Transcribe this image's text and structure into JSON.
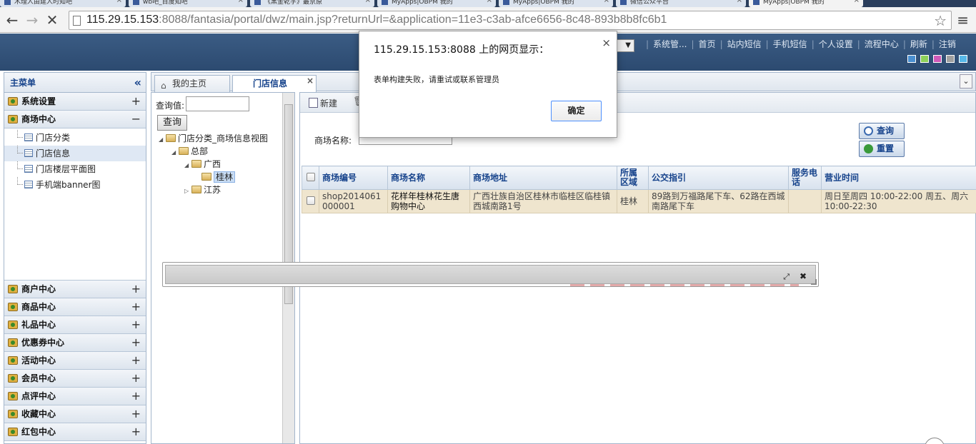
{
  "browser": {
    "tabs": [
      {
        "label": "木理人由建人时知吧"
      },
      {
        "label": "wb吧_百度知吧"
      },
      {
        "label": "《黑金乾学》最京原"
      },
      {
        "label": "MyApps|OBPM 我的"
      },
      {
        "label": "MyApps|OBPM 我的"
      },
      {
        "label": "微信公众平台"
      },
      {
        "label": "MyApps|OBPM 我的"
      }
    ],
    "url_host": "115.29.15.153",
    "url_rest": ":8088/fantasia/portal/dwz/main.jsp?returnUrl=&application=11e3-c3ab-afce6656-8c48-893b8b8fc6b1"
  },
  "header": {
    "links": [
      "系统管...",
      "首页",
      "站内短信",
      "手机短信",
      "个人设置",
      "流程中心",
      "刷新",
      "注销"
    ],
    "theme_colors": [
      "#4a8fd0",
      "#8ed15a",
      "#d05ab8",
      "#a0a0a0",
      "#57b8e8"
    ]
  },
  "sidebar": {
    "title": "主菜单",
    "groups_top": [
      {
        "label": "系统设置",
        "state": "+"
      },
      {
        "label": "商场中心",
        "state": "−"
      }
    ],
    "sub_items": [
      {
        "label": "门店分类"
      },
      {
        "label": "门店信息"
      },
      {
        "label": "门店楼层平面图"
      },
      {
        "label": "手机端banner图"
      }
    ],
    "groups_bottom": [
      {
        "label": "商户中心",
        "state": "+"
      },
      {
        "label": "商品中心",
        "state": "+"
      },
      {
        "label": "礼品中心",
        "state": "+"
      },
      {
        "label": "优惠券中心",
        "state": "+"
      },
      {
        "label": "活动中心",
        "state": "+"
      },
      {
        "label": "会员中心",
        "state": "+"
      },
      {
        "label": "点评中心",
        "state": "+"
      },
      {
        "label": "收藏中心",
        "state": "+"
      },
      {
        "label": "红包中心",
        "state": "+"
      }
    ]
  },
  "content_tabs": [
    {
      "label": "我的主页"
    },
    {
      "label": "门店信息"
    }
  ],
  "tree_panel": {
    "query_label": "查询值:",
    "query_button": "查询",
    "nodes": [
      {
        "label": "门店分类_商场信息视图"
      },
      {
        "label": "总部"
      },
      {
        "label": "广西"
      },
      {
        "label": "桂林"
      },
      {
        "label": "江苏"
      }
    ]
  },
  "grid_panel": {
    "new_label": "新建",
    "search_label": "商场名称:",
    "query_button": "查询",
    "reset_button": "重置",
    "columns": [
      "商场编号",
      "商场名称",
      "商场地址",
      "所属区域",
      "公交指引",
      "服务电话",
      "营业时间"
    ],
    "rows": [
      {
        "code": "shop2014061000001",
        "name": "花样年桂林花生唐购物中心",
        "address": "广西壮族自治区桂林市临桂区临桂镇西城南路1号",
        "region": "桂林",
        "bus": "89路到万福路尾下车、62路在西城南路尾下车",
        "phone": "",
        "hours": "周日至周四 10:00-22:00 周五、周六 10:00-22:30"
      }
    ]
  },
  "alert": {
    "title": "115.29.15.153:8088 上的网页显示：",
    "message": "表单构建失败，请重试或联系管理员",
    "ok": "确定",
    "close": "×"
  }
}
